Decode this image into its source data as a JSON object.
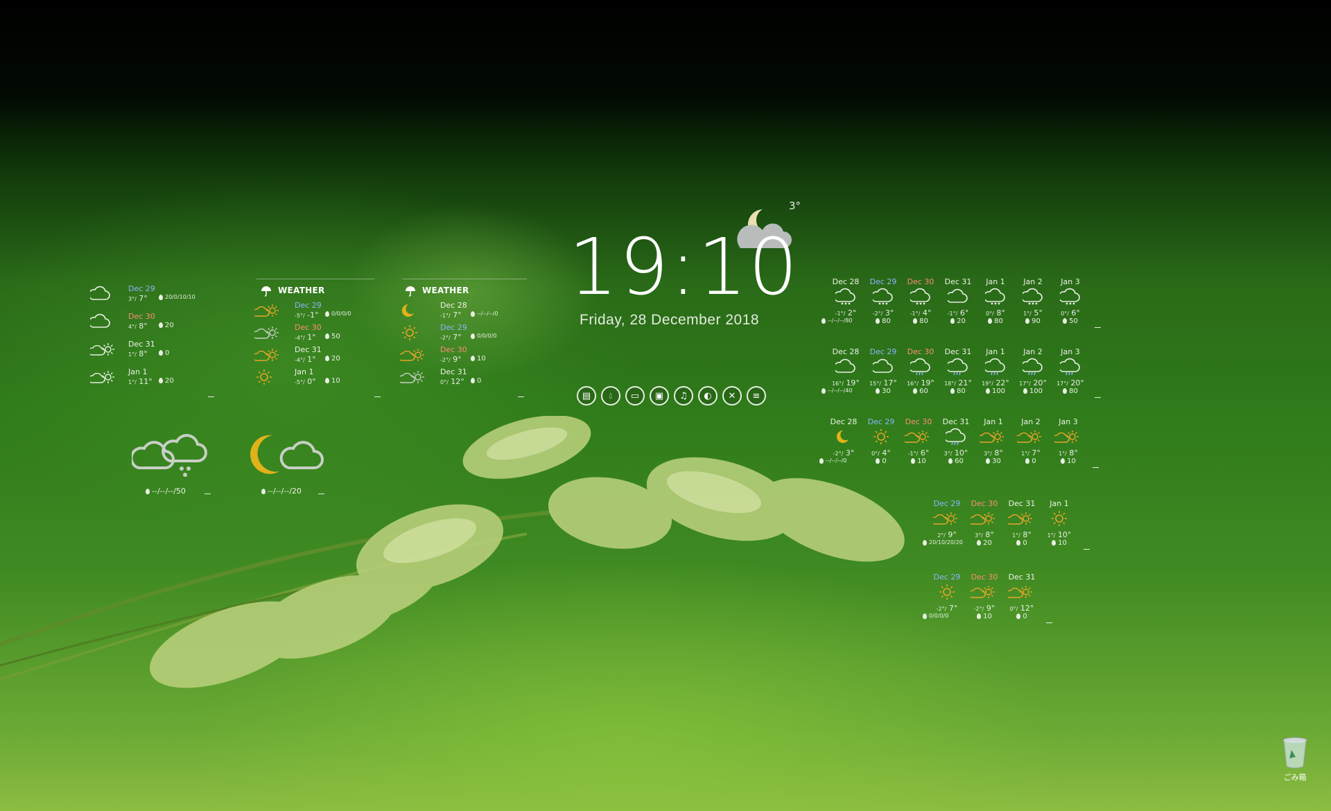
{
  "clock": {
    "time": "19:10",
    "date": "Friday, 28 December 2018",
    "current_temp": "3°"
  },
  "panel_a": {
    "rows": [
      {
        "date": "Dec 29",
        "lo": "3°/",
        "hi": "7°",
        "pr": "20/0/10/10",
        "date_color": "#8fb4ff",
        "icon": "cloud-icon"
      },
      {
        "date": "Dec 30",
        "lo": "4°/",
        "hi": "8°",
        "pr": "20",
        "date_color": "#ff8d7a",
        "icon": "cloud-icon"
      },
      {
        "date": "Dec 31",
        "lo": "1°/",
        "hi": "8°",
        "pr": "0",
        "date_color": "#eef3e8",
        "icon": "cloud-sun-icon"
      },
      {
        "date": "Jan 1",
        "lo": "1°/",
        "hi": "11°",
        "pr": "20",
        "date_color": "#eef3e8",
        "icon": "cloud-sun-icon"
      }
    ]
  },
  "panel_b": {
    "header": "WEATHER",
    "rows": [
      {
        "date": "Dec 29",
        "lo": "-5°/",
        "hi": "-1°",
        "pr": "0/0/0/0",
        "date_color": "#8fb4ff"
      },
      {
        "date": "Dec 30",
        "lo": "-4°/",
        "hi": "1°",
        "pr": "50",
        "date_color": "#ff8d7a"
      },
      {
        "date": "Dec 31",
        "lo": "-4°/",
        "hi": "1°",
        "pr": "20",
        "date_color": "#eef3e8"
      },
      {
        "date": "Jan 1",
        "lo": "-5°/",
        "hi": "0°",
        "pr": "10",
        "date_color": "#eef3e8"
      }
    ]
  },
  "panel_c": {
    "header": "WEATHER",
    "rows": [
      {
        "date": "Dec 28",
        "lo": "-1°/",
        "hi": "7°",
        "pr": "--/--/--/0",
        "date_color": "#eef3e8"
      },
      {
        "date": "Dec 29",
        "lo": "-2°/",
        "hi": "7°",
        "pr": "0/0/0/0",
        "date_color": "#8fb4ff"
      },
      {
        "date": "Dec 30",
        "lo": "-2°/",
        "hi": "9°",
        "pr": "10",
        "date_color": "#ff8d7a"
      },
      {
        "date": "Dec 31",
        "lo": "0°/",
        "hi": "12°",
        "pr": "0",
        "date_color": "#eef3e8"
      }
    ]
  },
  "big_icons": [
    {
      "pr": "--/--/--/50"
    },
    {
      "pr": "--/--/--/20"
    }
  ],
  "launcher": [
    "drive-icon",
    "water-drop-icon",
    "folder-icon",
    "save-icon",
    "music-icon",
    "browser-icon",
    "tools-icon",
    "document-icon"
  ],
  "grid_rows": [
    {
      "cols": [
        {
          "date": "Dec 28",
          "c": "#eef3e8",
          "lo": "-1°/",
          "hi": "2°",
          "pr": "--/--/--/80"
        },
        {
          "date": "Dec 29",
          "c": "#8fb4ff",
          "lo": "-2°/",
          "hi": "3°",
          "pr": "80"
        },
        {
          "date": "Dec 30",
          "c": "#ff8d7a",
          "lo": "-1°/",
          "hi": "4°",
          "pr": "80"
        },
        {
          "date": "Dec 31",
          "c": "#eef3e8",
          "lo": "-1°/",
          "hi": "6°",
          "pr": "20"
        },
        {
          "date": "Jan 1",
          "c": "#eef3e8",
          "lo": "0°/",
          "hi": "8°",
          "pr": "80"
        },
        {
          "date": "Jan 2",
          "c": "#eef3e8",
          "lo": "1°/",
          "hi": "5°",
          "pr": "90"
        },
        {
          "date": "Jan 3",
          "c": "#eef3e8",
          "lo": "0°/",
          "hi": "6°",
          "pr": "50"
        }
      ]
    },
    {
      "cols": [
        {
          "date": "Dec 28",
          "c": "#eef3e8",
          "lo": "16°/",
          "hi": "19°",
          "pr": "--/--/--/40"
        },
        {
          "date": "Dec 29",
          "c": "#8fb4ff",
          "lo": "15°/",
          "hi": "17°",
          "pr": "30"
        },
        {
          "date": "Dec 30",
          "c": "#ff8d7a",
          "lo": "16°/",
          "hi": "19°",
          "pr": "60"
        },
        {
          "date": "Dec 31",
          "c": "#eef3e8",
          "lo": "18°/",
          "hi": "21°",
          "pr": "80"
        },
        {
          "date": "Jan 1",
          "c": "#eef3e8",
          "lo": "19°/",
          "hi": "22°",
          "pr": "100"
        },
        {
          "date": "Jan 2",
          "c": "#eef3e8",
          "lo": "17°/",
          "hi": "20°",
          "pr": "100"
        },
        {
          "date": "Jan 3",
          "c": "#eef3e8",
          "lo": "17°/",
          "hi": "20°",
          "pr": "80"
        }
      ]
    },
    {
      "cols": [
        {
          "date": "Dec 28",
          "c": "#eef3e8",
          "lo": "-2°/",
          "hi": "3°",
          "pr": "--/--/--/0"
        },
        {
          "date": "Dec 29",
          "c": "#8fb4ff",
          "lo": "0°/",
          "hi": "4°",
          "pr": "0"
        },
        {
          "date": "Dec 30",
          "c": "#ff8d7a",
          "lo": "-1°/",
          "hi": "6°",
          "pr": "10"
        },
        {
          "date": "Dec 31",
          "c": "#eef3e8",
          "lo": "3°/",
          "hi": "10°",
          "pr": "60"
        },
        {
          "date": "Jan 1",
          "c": "#eef3e8",
          "lo": "3°/",
          "hi": "8°",
          "pr": "30"
        },
        {
          "date": "Jan 2",
          "c": "#eef3e8",
          "lo": "1°/",
          "hi": "7°",
          "pr": "0"
        },
        {
          "date": "Jan 3",
          "c": "#eef3e8",
          "lo": "1°/",
          "hi": "8°",
          "pr": "10"
        }
      ]
    },
    {
      "cols": [
        {
          "date": "Dec 29",
          "c": "#8fb4ff",
          "lo": "2°/",
          "hi": "9°",
          "pr": "20/10/20/20"
        },
        {
          "date": "Dec 30",
          "c": "#ff8d7a",
          "lo": "3°/",
          "hi": "8°",
          "pr": "20"
        },
        {
          "date": "Dec 31",
          "c": "#eef3e8",
          "lo": "1°/",
          "hi": "8°",
          "pr": "0"
        },
        {
          "date": "Jan 1",
          "c": "#eef3e8",
          "lo": "1°/",
          "hi": "10°",
          "pr": "10"
        }
      ]
    },
    {
      "cols": [
        {
          "date": "Dec 29",
          "c": "#8fb4ff",
          "lo": "-2°/",
          "hi": "7°",
          "pr": "0/0/0/0"
        },
        {
          "date": "Dec 30",
          "c": "#ff8d7a",
          "lo": "-2°/",
          "hi": "9°",
          "pr": "10"
        },
        {
          "date": "Dec 31",
          "c": "#eef3e8",
          "lo": "0°/",
          "hi": "12°",
          "pr": "0"
        }
      ]
    }
  ],
  "trash": {
    "label": "ごみ箱"
  }
}
